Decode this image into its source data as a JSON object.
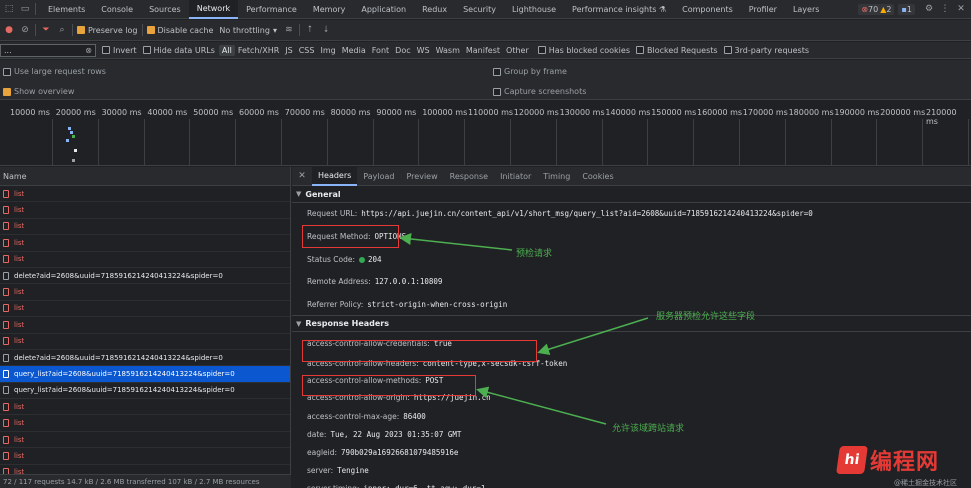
{
  "tabs": [
    "Elements",
    "Console",
    "Sources",
    "Network",
    "Performance",
    "Memory",
    "Application",
    "Redux",
    "Security",
    "Lighthouse",
    "Performance insights ⚗",
    "Components",
    "Profiler",
    "Layers"
  ],
  "badges": {
    "errors": "70",
    "warnings": "2",
    "messages": "1"
  },
  "toolbar": {
    "preserve_log": "Preserve log",
    "disable_cache": "Disable cache",
    "throttling": "No throttling"
  },
  "filter": {
    "value": "...",
    "invert": "Invert",
    "hide_data_urls": "Hide data URLs",
    "types": [
      "All",
      "Fetch/XHR",
      "JS",
      "CSS",
      "Img",
      "Media",
      "Font",
      "Doc",
      "WS",
      "Wasm",
      "Manifest",
      "Other"
    ],
    "blocked_cookies": "Has blocked cookies",
    "blocked_requests": "Blocked Requests",
    "third_party": "3rd-party requests"
  },
  "options": {
    "large_rows": "Use large request rows",
    "overview": "Show overview",
    "group_frame": "Group by frame",
    "capture": "Capture screenshots"
  },
  "timeline": {
    "ticks": [
      "10000 ms",
      "20000 ms",
      "30000 ms",
      "40000 ms",
      "50000 ms",
      "60000 ms",
      "70000 ms",
      "80000 ms",
      "90000 ms",
      "100000 ms",
      "110000 ms",
      "120000 ms",
      "130000 ms",
      "140000 ms",
      "150000 ms",
      "160000 ms",
      "170000 ms",
      "180000 ms",
      "190000 ms",
      "200000 ms",
      "210000 ms"
    ]
  },
  "list": {
    "header": "Name",
    "rows": [
      {
        "name": "list",
        "kind": "err"
      },
      {
        "name": "list",
        "kind": "err"
      },
      {
        "name": "list",
        "kind": "err"
      },
      {
        "name": "list",
        "kind": "err"
      },
      {
        "name": "list",
        "kind": "err"
      },
      {
        "name": "delete?aid=2608&uuid=7185916214240413224&spider=0",
        "kind": "ok"
      },
      {
        "name": "list",
        "kind": "err"
      },
      {
        "name": "list",
        "kind": "err"
      },
      {
        "name": "list",
        "kind": "err"
      },
      {
        "name": "list",
        "kind": "err"
      },
      {
        "name": "delete?aid=2608&uuid=7185916214240413224&spider=0",
        "kind": "ok"
      },
      {
        "name": "query_list?aid=2608&uuid=7185916214240413224&spider=0",
        "kind": "sel"
      },
      {
        "name": "query_list?aid=2608&uuid=7185916214240413224&spider=0",
        "kind": "ok"
      },
      {
        "name": "list",
        "kind": "err"
      },
      {
        "name": "list",
        "kind": "err"
      },
      {
        "name": "list",
        "kind": "err"
      },
      {
        "name": "list",
        "kind": "err"
      },
      {
        "name": "list",
        "kind": "err"
      }
    ],
    "status": "72 / 117 requests    14.7 kB / 2.6 MB transferred    107 kB / 2.7 MB resources"
  },
  "detail": {
    "tabs": [
      "Headers",
      "Payload",
      "Preview",
      "Response",
      "Initiator",
      "Timing",
      "Cookies"
    ],
    "general_title": "General",
    "general": [
      {
        "k": "Request URL:",
        "v": "https://api.juejin.cn/content_api/v1/short_msg/query_list?aid=2608&uuid=7185916214240413224&spider=0"
      },
      {
        "k": "Request Method:",
        "v": "OPTIONS"
      },
      {
        "k": "Status Code:",
        "v": "204"
      },
      {
        "k": "Remote Address:",
        "v": "127.0.0.1:10809"
      },
      {
        "k": "Referrer Policy:",
        "v": "strict-origin-when-cross-origin"
      }
    ],
    "response_title": "Response Headers",
    "response": [
      {
        "k": "access-control-allow-credentials:",
        "v": "true"
      },
      {
        "k": "access-control-allow-headers:",
        "v": "content-type,x-secsdk-csrf-token"
      },
      {
        "k": "access-control-allow-methods:",
        "v": "POST"
      },
      {
        "k": "access-control-allow-origin:",
        "v": "https://juejin.cn"
      },
      {
        "k": "access-control-max-age:",
        "v": "86400"
      },
      {
        "k": "date:",
        "v": "Tue, 22 Aug 2023 01:35:07 GMT"
      },
      {
        "k": "eagleid:",
        "v": "790b029a16926681079485916e"
      },
      {
        "k": "server:",
        "v": "Tengine"
      },
      {
        "k": "server-timing:",
        "v": "inner; dur=6, tt_agw; dur=1"
      }
    ]
  },
  "annotations": {
    "preflight": "预检请求",
    "server_allows": "服务器预检允许这些字段",
    "allow_origin": "允许该域跨站请求"
  },
  "watermark": {
    "logo": "hi",
    "text": "编程网",
    "sub": "@稀土掘金技术社区"
  },
  "colors": {
    "accent": "#8ab4f8",
    "annotation": "#4caf50",
    "highlight_box": "#e53935",
    "selected_row": "#0b57d0",
    "error_text": "#e46962"
  }
}
